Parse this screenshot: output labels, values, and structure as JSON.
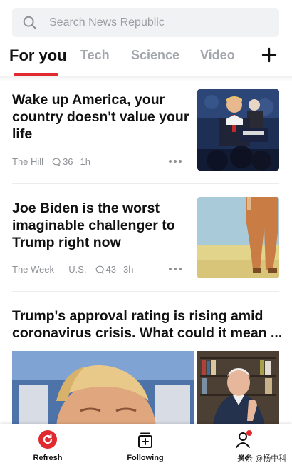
{
  "search": {
    "placeholder": "Search News Republic"
  },
  "tabs": [
    {
      "label": "For you",
      "active": true
    },
    {
      "label": "Tech"
    },
    {
      "label": "Science"
    },
    {
      "label": "Video"
    }
  ],
  "articles": [
    {
      "title": "Wake up America, your country doesn't value your life",
      "source": "The Hill",
      "comments": "36",
      "time": "1h",
      "thumb_icon": "trump-press-briefing-photo"
    },
    {
      "title": "Joe Biden is the worst imaginable challenger to Trump right now",
      "source": "The Week — U.S.",
      "comments": "43",
      "time": "3h",
      "thumb_icon": "legs-on-stage-photo"
    },
    {
      "title": "Trump's approval rating is rising amid coronavirus crisis. What could it mean ...",
      "images": [
        "trump-closeup-photo",
        "biden-bookshelf-photo"
      ]
    }
  ],
  "bottom_nav": {
    "refresh": "Refresh",
    "following": "Following",
    "me": "Me"
  },
  "watermark": "头条 @杨中科",
  "colors": {
    "accent": "#e02a2f",
    "muted": "#8e9196",
    "search_bg": "#f1f2f4"
  }
}
